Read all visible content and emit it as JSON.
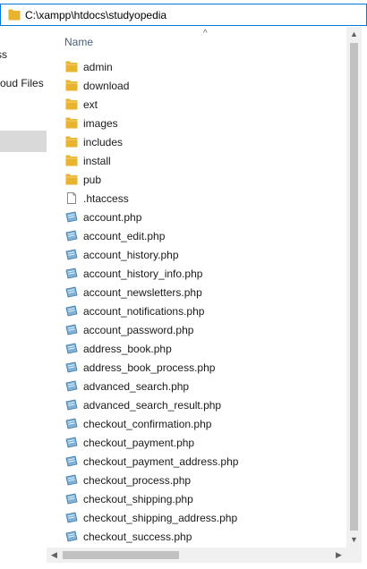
{
  "address": {
    "path": "C:\\xampp\\htdocs\\studyopedia"
  },
  "navigation": {
    "items": [
      {
        "label": "ss"
      },
      {
        "label": "oud Files"
      },
      {
        "label": ""
      }
    ]
  },
  "file_list": {
    "column_header": "Name",
    "sort_indicator": "^",
    "items": [
      {
        "name": "admin",
        "type": "folder"
      },
      {
        "name": "download",
        "type": "folder"
      },
      {
        "name": "ext",
        "type": "folder"
      },
      {
        "name": "images",
        "type": "folder"
      },
      {
        "name": "includes",
        "type": "folder"
      },
      {
        "name": "install",
        "type": "folder"
      },
      {
        "name": "pub",
        "type": "folder"
      },
      {
        "name": ".htaccess",
        "type": "file"
      },
      {
        "name": "account.php",
        "type": "php"
      },
      {
        "name": "account_edit.php",
        "type": "php"
      },
      {
        "name": "account_history.php",
        "type": "php"
      },
      {
        "name": "account_history_info.php",
        "type": "php"
      },
      {
        "name": "account_newsletters.php",
        "type": "php"
      },
      {
        "name": "account_notifications.php",
        "type": "php"
      },
      {
        "name": "account_password.php",
        "type": "php"
      },
      {
        "name": "address_book.php",
        "type": "php"
      },
      {
        "name": "address_book_process.php",
        "type": "php"
      },
      {
        "name": "advanced_search.php",
        "type": "php"
      },
      {
        "name": "advanced_search_result.php",
        "type": "php"
      },
      {
        "name": "checkout_confirmation.php",
        "type": "php"
      },
      {
        "name": "checkout_payment.php",
        "type": "php"
      },
      {
        "name": "checkout_payment_address.php",
        "type": "php"
      },
      {
        "name": "checkout_process.php",
        "type": "php"
      },
      {
        "name": "checkout_shipping.php",
        "type": "php"
      },
      {
        "name": "checkout_shipping_address.php",
        "type": "php"
      },
      {
        "name": "checkout_success.php",
        "type": "php"
      }
    ]
  },
  "scrollbars": {
    "vertical_position": 0.0,
    "horizontal_position": 0.0
  },
  "colors": {
    "accent": "#0078d7",
    "folder": "#e8b32e",
    "header_text": "#4c607a",
    "selection": "#d9d9d9"
  }
}
